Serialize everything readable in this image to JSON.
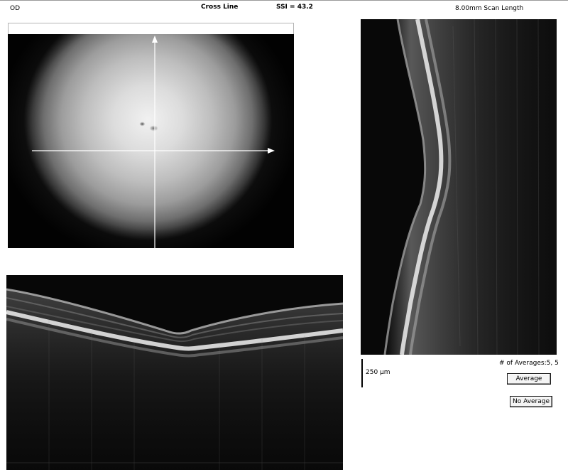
{
  "header": {
    "eye": "OD",
    "scan_type": "Cross Line",
    "ssi": "SSI = 43.2",
    "scan_length": "8.00mm Scan Length"
  },
  "scan_info": {
    "averages": "# of Averages:5, 5",
    "scale_label": "250 µm"
  },
  "buttons": {
    "average": "Average",
    "no_average": "No Average"
  },
  "colors": {
    "background": "#ffffff",
    "scan_background": "#080808",
    "crosshair": "#ffffff"
  }
}
